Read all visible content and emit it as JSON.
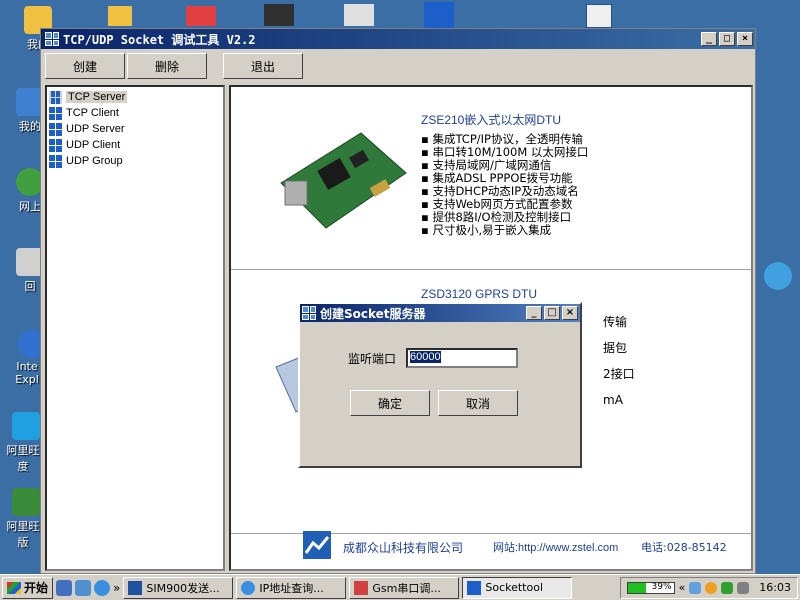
{
  "desktop": {
    "icons": [
      {
        "label": "我的",
        "color": "#f0c040",
        "icon": "folder-icon"
      },
      {
        "label": "我的",
        "color": "#4080d0",
        "icon": "computer-icon"
      },
      {
        "label": "网上",
        "color": "#40a040",
        "icon": "network-icon"
      },
      {
        "label": "回",
        "color": "#d0d0d0",
        "icon": "recycle-bin-icon"
      },
      {
        "label": "Inte Expl",
        "color": "#3070d0",
        "icon": "ie-icon"
      },
      {
        "label": "阿里旺 度",
        "color": "#20a0e0",
        "icon": "aliwangwang-icon"
      },
      {
        "label": "阿里旺 版",
        "color": "#3a8a3a",
        "icon": "aliwangwang-icon"
      }
    ]
  },
  "window": {
    "title": "TCP/UDP Socket 调试工具 V2.2",
    "minimize": "_",
    "maximize": "□",
    "close": "×"
  },
  "toolbar": {
    "create_label": "创建",
    "delete_label": "删除",
    "exit_label": "退出"
  },
  "tree": {
    "items": [
      {
        "label": "TCP Server"
      },
      {
        "label": "TCP Client"
      },
      {
        "label": "UDP Server"
      },
      {
        "label": "UDP Client"
      },
      {
        "label": "UDP Group"
      }
    ]
  },
  "content": {
    "product1_title": "ZSE210嵌入式以太网DTU",
    "product1_features": [
      "集成TCP/IP协议，全透明传输",
      "串口转10M/100M 以太网接口",
      "支持局域网/广域网通信",
      "集成ADSL PPPOE拨号功能",
      "支持DHCP动态IP及动态域名",
      "支持Web网页方式配置参数",
      "提供8路I/O检测及控制接口",
      "尺寸极小,易于嵌入集成"
    ],
    "product2_title": "ZSD3120 GPRS DTU",
    "product2_frag1": "传输",
    "product2_frag2": "据包",
    "product2_frag3": "2接口",
    "product2_frag4": "mA",
    "footer_company": "成都众山科技有限公司",
    "footer_site": "网站:http://www.zstel.com",
    "footer_phone": "电话:028-85142"
  },
  "dialog": {
    "title": "创建Socket服务器",
    "port_label": "监听端口",
    "port_value": "60000",
    "ok_label": "确定",
    "cancel_label": "取消"
  },
  "taskbar": {
    "start_label": "开始",
    "chevron": "»",
    "buttons": [
      {
        "label": "SIM900发送..."
      },
      {
        "label": "IP地址查询..."
      },
      {
        "label": "Gsm串口调..."
      },
      {
        "label": "Sockettool"
      }
    ],
    "battery": {
      "percent_label": "39%",
      "level": 0.39
    },
    "clock": "16:03"
  }
}
